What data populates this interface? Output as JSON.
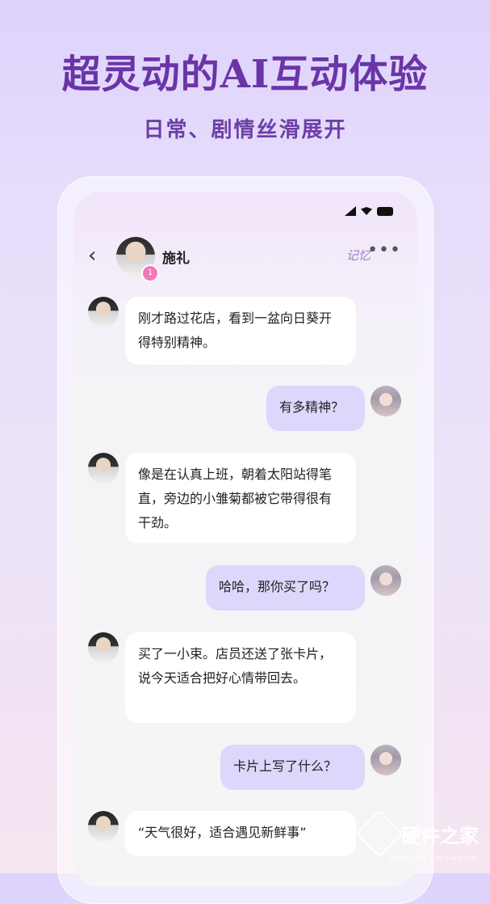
{
  "hero": {
    "title": "超灵动的AI互动体验",
    "subtitle": "日常、剧情丝滑展开"
  },
  "chat_header": {
    "back_icon": "chevron-left-icon",
    "name": "施礼",
    "level_badge": "1",
    "memory_label": "记忆",
    "more_icon": "more-horizontal-icon"
  },
  "messages": [
    {
      "side": "left",
      "text": "刚才路过花店，看到一盆向日葵开得特别精神。"
    },
    {
      "side": "right",
      "text": "有多精神？"
    },
    {
      "side": "left",
      "text": "像是在认真上班，朝着太阳站得笔直，旁边的小雏菊都被它带得很有干劲。"
    },
    {
      "side": "right",
      "text": "哈哈，那你买了吗？"
    },
    {
      "side": "left",
      "text": "买了一小束。店员还送了张卡片，说今天适合把好心情带回去。"
    },
    {
      "side": "right",
      "text": "卡片上写了什么？"
    },
    {
      "side": "left",
      "text": "“天气很好，适合遇见新鲜事”"
    }
  ],
  "watermark": {
    "text": "硬件之家",
    "sub": "YING JIAN ZHI JIA.COM"
  },
  "colors": {
    "title": "#6a35a8",
    "bubble_right": "#ddd7fb",
    "bubble_left": "#ffffff"
  }
}
